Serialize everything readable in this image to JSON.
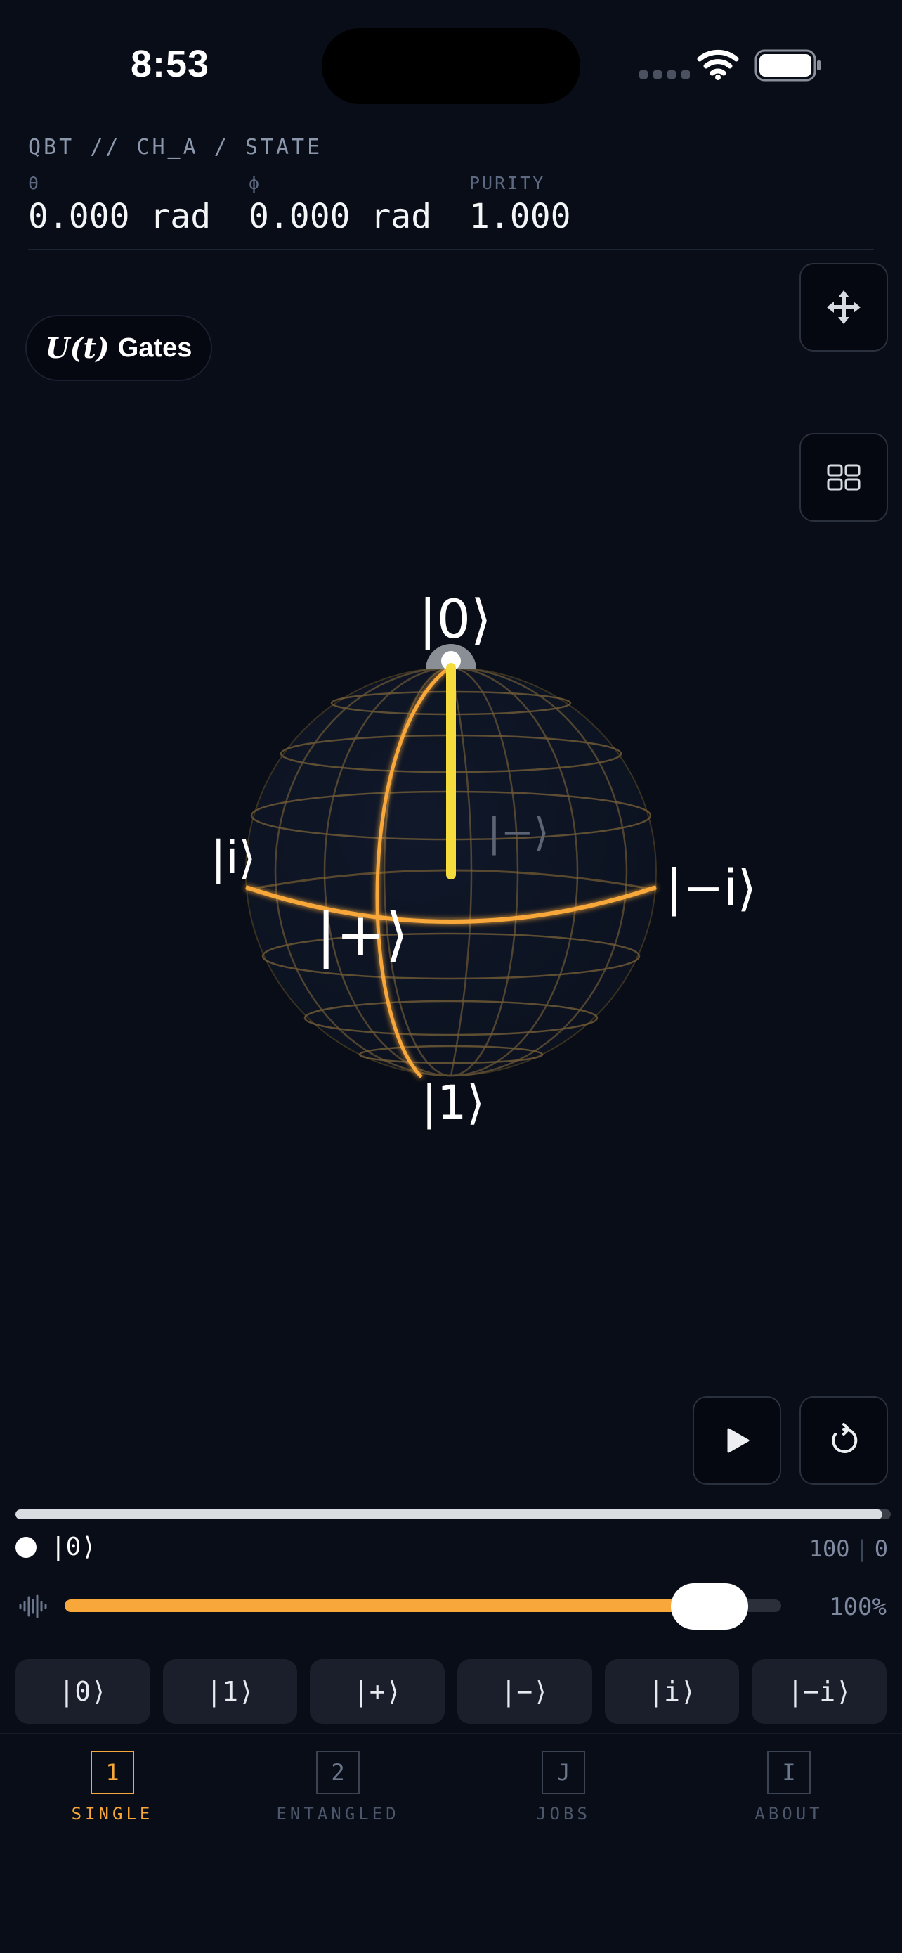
{
  "status_bar": {
    "time": "8:53"
  },
  "header": {
    "title": "QBT // CH_A / STATE",
    "metrics": [
      {
        "label": "θ",
        "value": "0.000 rad"
      },
      {
        "label": "ϕ",
        "value": "0.000 rad"
      },
      {
        "label": "PURITY",
        "value": "1.000"
      }
    ]
  },
  "toolbar": {
    "gates_math": "U(t)",
    "gates_label": "Gates",
    "move_icon": "move-icon",
    "grid_icon": "grid-icon"
  },
  "bloch": {
    "labels": {
      "zero": "|0⟩",
      "one": "|1⟩",
      "plus": "|+⟩",
      "minus": "|−⟩",
      "i": "|i⟩",
      "minus_i": "|−i⟩"
    },
    "colors": {
      "accent": "#f8a83a",
      "vector": "#f5dc3c"
    }
  },
  "playback": {
    "play_icon": "play-icon",
    "reset_icon": "reset-icon"
  },
  "progress": {
    "state": "|0⟩",
    "fraction": 0.99,
    "count_a": "100",
    "count_b": "0"
  },
  "amplitude": {
    "fraction": 0.9,
    "value_label": "100%",
    "icon": "waveform-icon"
  },
  "presets": [
    "|0⟩",
    "|1⟩",
    "|+⟩",
    "|−⟩",
    "|i⟩",
    "|−i⟩"
  ],
  "tabs": [
    {
      "key": "1",
      "label": "SINGLE",
      "active": true
    },
    {
      "key": "2",
      "label": "ENTANGLED",
      "active": false
    },
    {
      "key": "J",
      "label": "JOBS",
      "active": false
    },
    {
      "key": "I",
      "label": "ABOUT",
      "active": false
    }
  ],
  "theme": {
    "background": "#090d18",
    "accent": "#f8a83a",
    "muted": "#7f8aa0"
  }
}
